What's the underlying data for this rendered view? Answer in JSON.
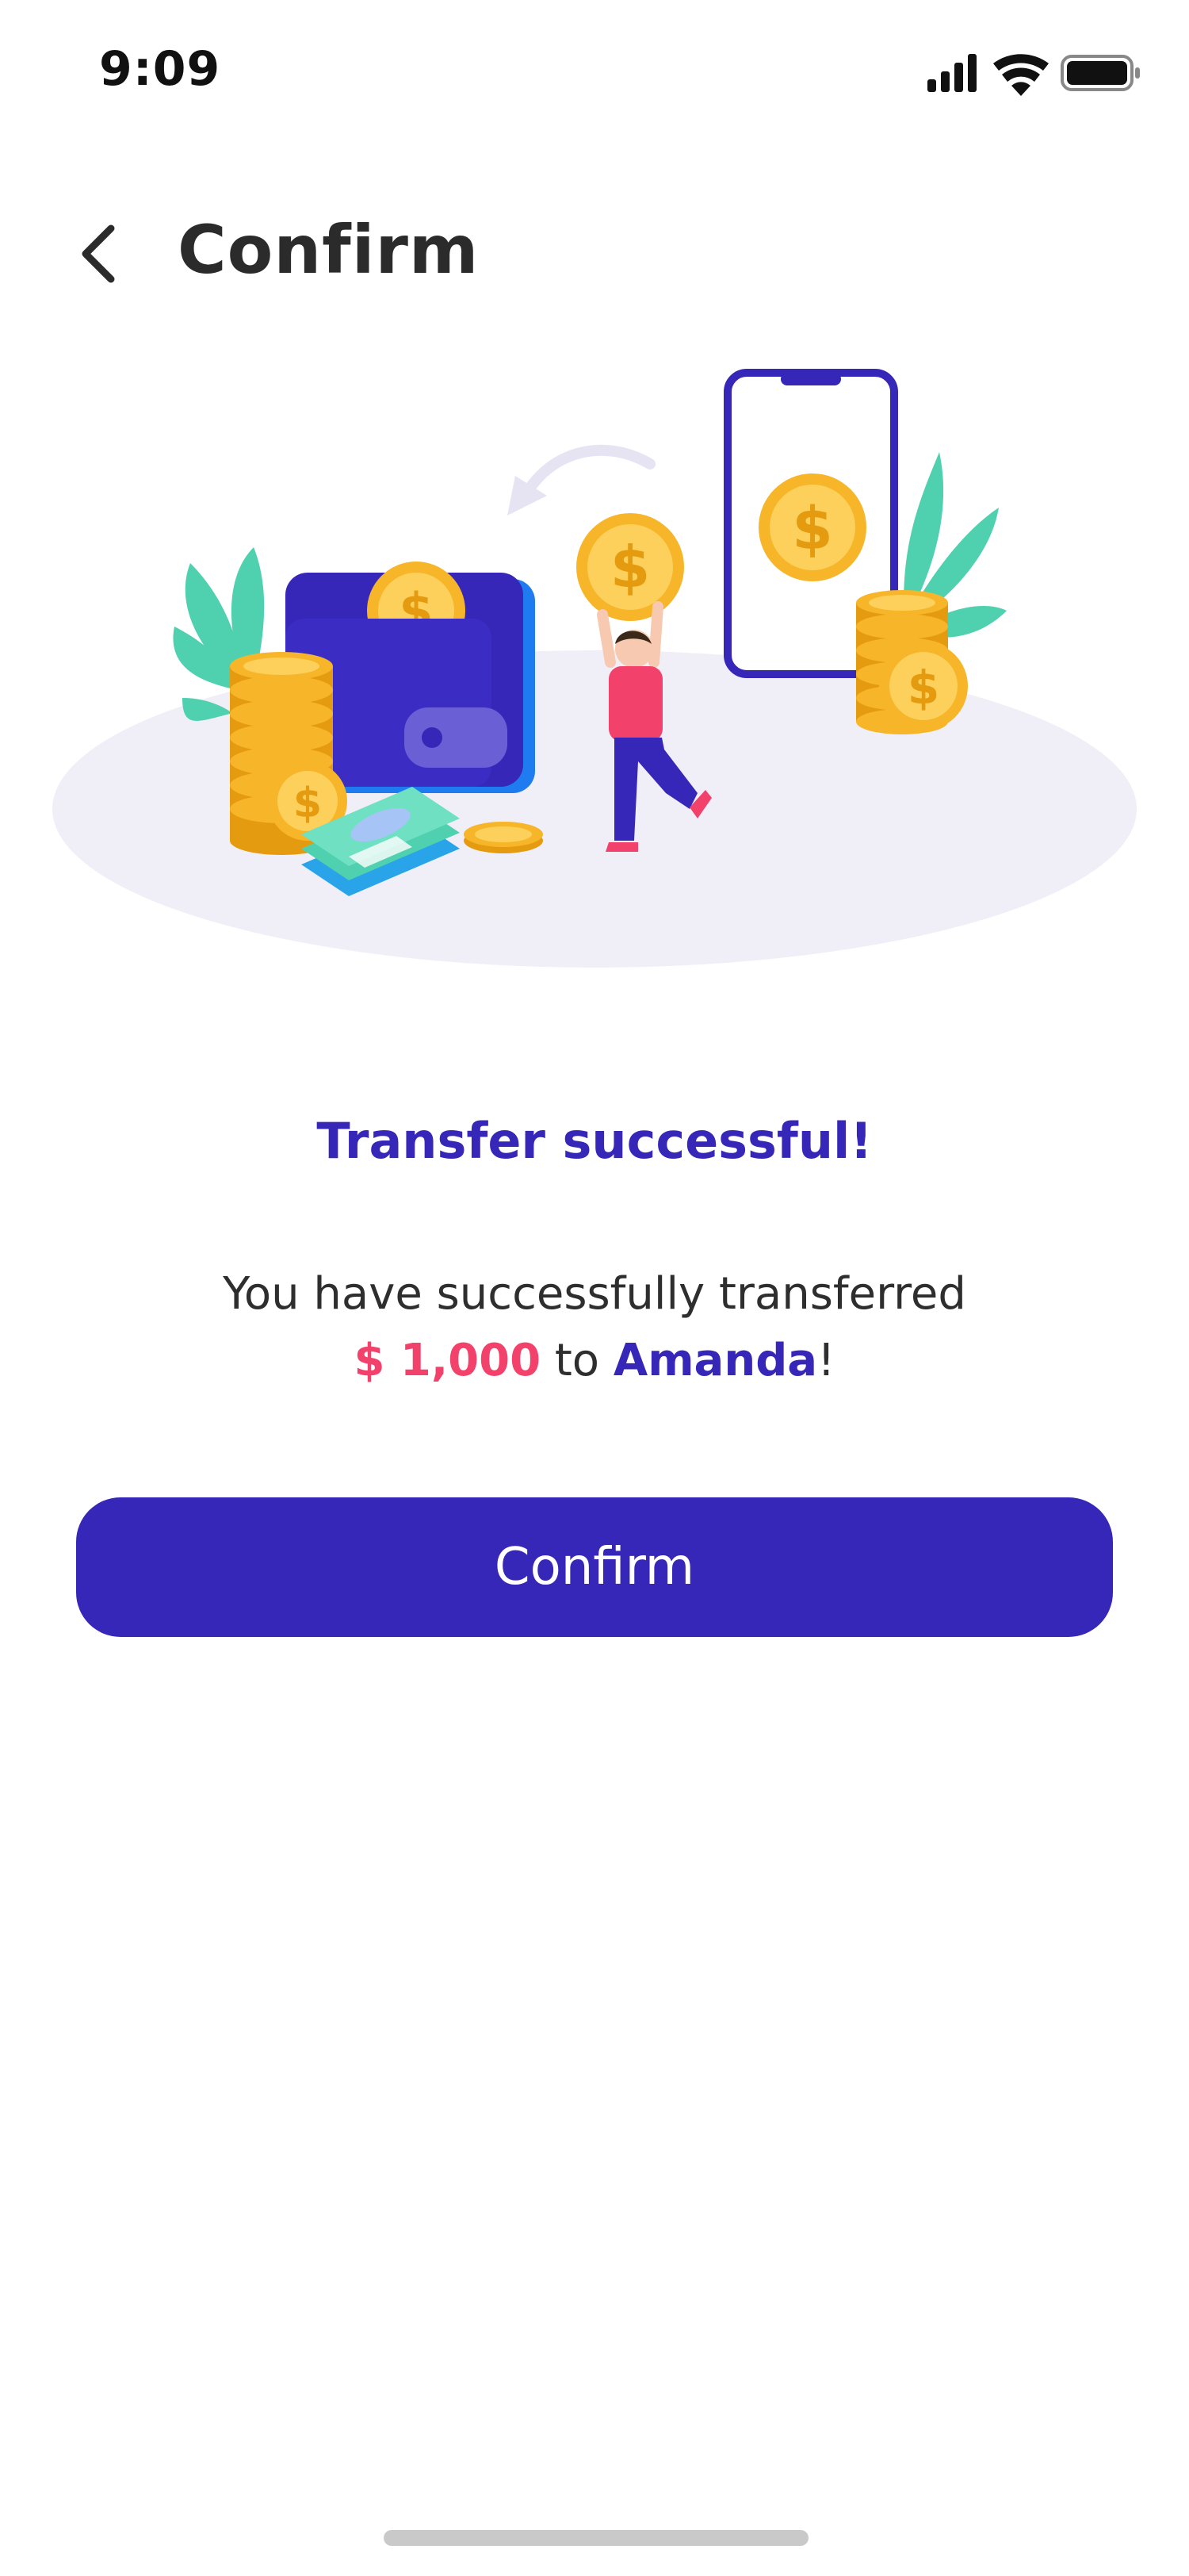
{
  "status_bar": {
    "time": "9:09",
    "icons": [
      "cellular-signal-icon",
      "wifi-icon",
      "battery-icon"
    ]
  },
  "header": {
    "back_icon": "chevron-left-icon",
    "title": "Confirm"
  },
  "illustration": {
    "coin_symbol": "$",
    "icons": [
      "wallet-icon",
      "coin-stack-icon",
      "phone-icon",
      "banknotes-icon",
      "person-icon",
      "plant-icon",
      "transfer-arrow-icon"
    ]
  },
  "message": {
    "title": "Transfer successful!",
    "line1": "You have successfully transferred",
    "amount": "$ 1,000",
    "connector": " to ",
    "recipient": "Amanda",
    "suffix": "!"
  },
  "actions": {
    "confirm_label": "Confirm"
  },
  "colors": {
    "primary": "#3727b8",
    "accent": "#f2426b",
    "coin": "#f7b529",
    "leaf": "#4fd1b0"
  }
}
